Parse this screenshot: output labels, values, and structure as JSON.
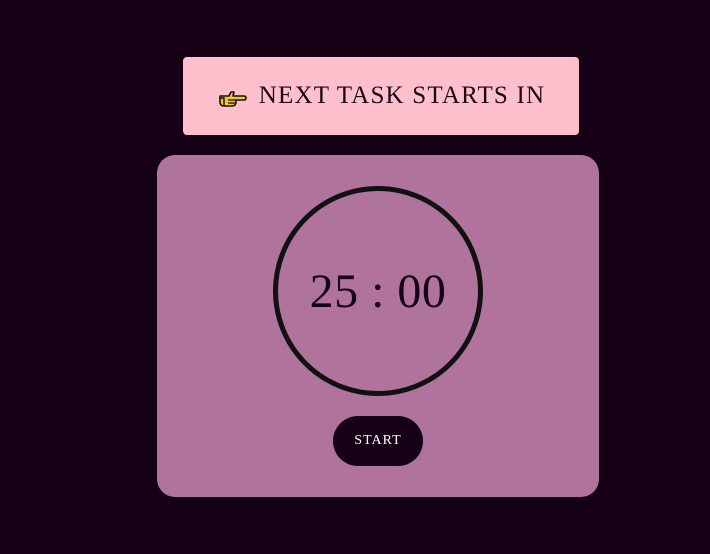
{
  "banner": {
    "icon": "backhand-index-pointing-right-icon",
    "text": "NEXT TASK STARTS IN"
  },
  "timer": {
    "display": "25 : 00"
  },
  "controls": {
    "start_label": "START"
  },
  "colors": {
    "background": "#150016",
    "banner_bg": "#ffbfcd",
    "card_bg": "#b0739c",
    "ring": "#111111",
    "button_bg": "#150016",
    "button_text": "#ffffff"
  }
}
